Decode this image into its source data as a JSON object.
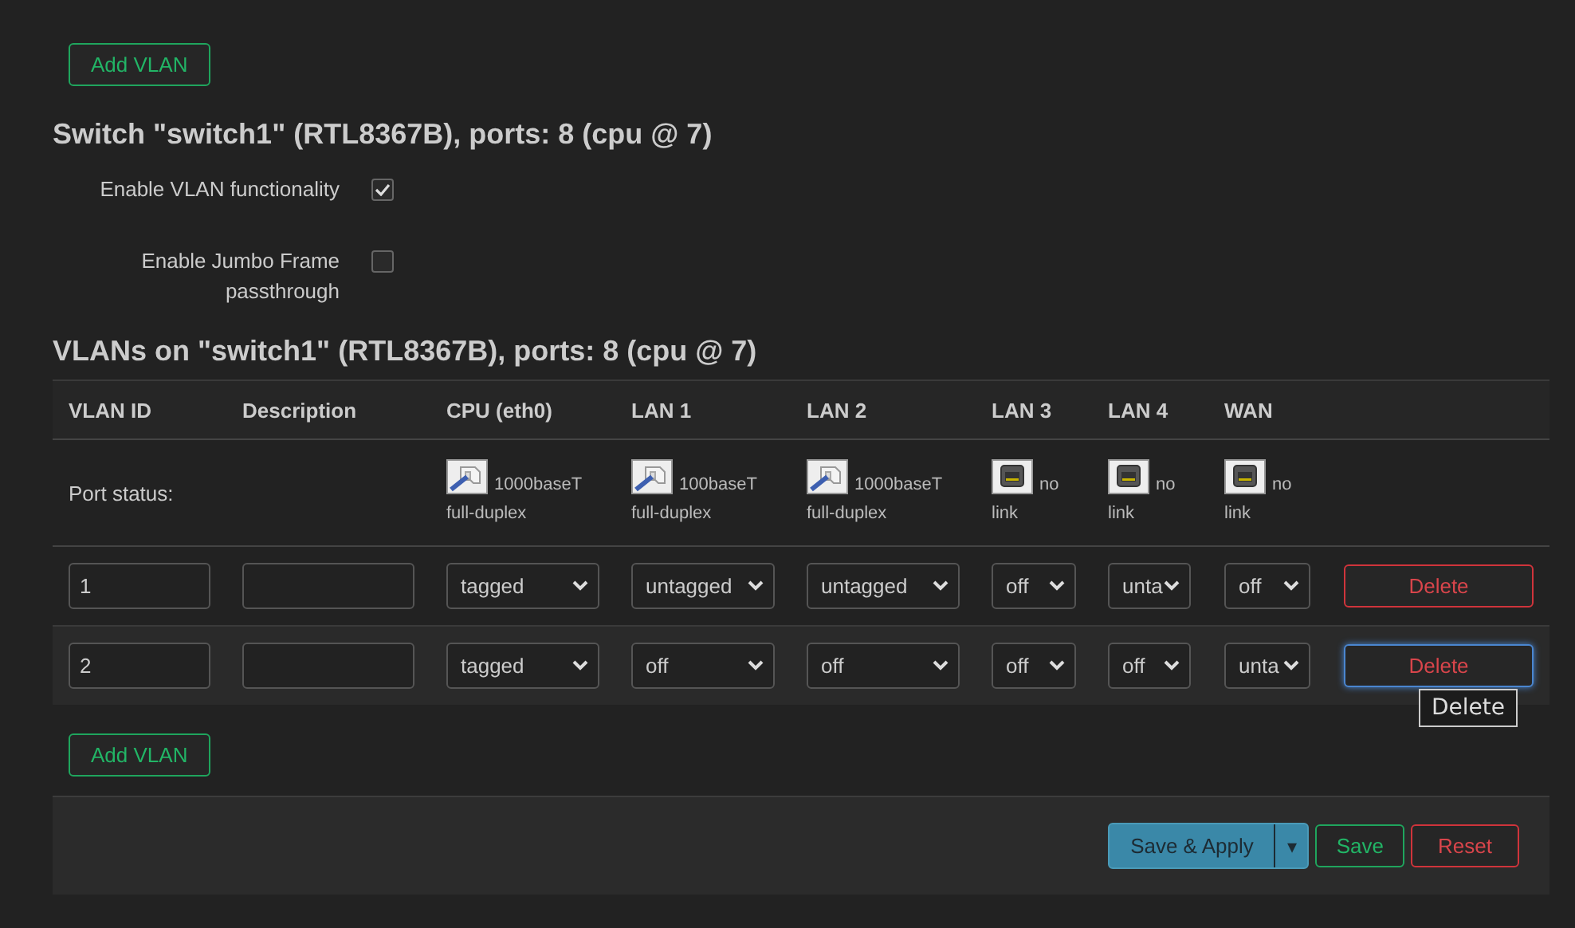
{
  "top_button": "Add VLAN",
  "switch_title": "Switch \"switch1\" (RTL8367B), ports: 8 (cpu @ 7)",
  "options": [
    {
      "label": "Enable VLAN functionality",
      "checked": true
    },
    {
      "label": "Enable Jumbo Frame passthrough",
      "checked": false
    }
  ],
  "vlans_title": "VLANs on \"switch1\" (RTL8367B), ports: 8 (cpu @ 7)",
  "table": {
    "columns": [
      "VLAN ID",
      "Description",
      "CPU (eth0)",
      "LAN 1",
      "LAN 2",
      "LAN 3",
      "LAN 4",
      "WAN"
    ],
    "port_status_label": "Port status:",
    "port_status": [
      {
        "linked": true,
        "line1": "1000baseT",
        "line2": "full-duplex"
      },
      {
        "linked": true,
        "line1": "100baseT",
        "line2": "full-duplex"
      },
      {
        "linked": true,
        "line1": "1000baseT",
        "line2": "full-duplex"
      },
      {
        "linked": false,
        "line1": "no",
        "line2": "link"
      },
      {
        "linked": false,
        "line1": "no",
        "line2": "link"
      },
      {
        "linked": false,
        "line1": "no",
        "line2": "link"
      }
    ],
    "rows": [
      {
        "vlan_id": "1",
        "ports": [
          "tagged",
          "untagged",
          "untagged",
          "off",
          "unta",
          "off"
        ],
        "delete": "Delete",
        "focused": false
      },
      {
        "vlan_id": "2",
        "ports": [
          "tagged",
          "off",
          "off",
          "off",
          "off",
          "unta"
        ],
        "delete": "Delete",
        "focused": true
      }
    ]
  },
  "tooltip": "Delete",
  "bottom_button": "Add VLAN",
  "footer": {
    "save_apply": "Save & Apply",
    "menu_glyph": "▾",
    "save": "Save",
    "reset": "Reset"
  }
}
